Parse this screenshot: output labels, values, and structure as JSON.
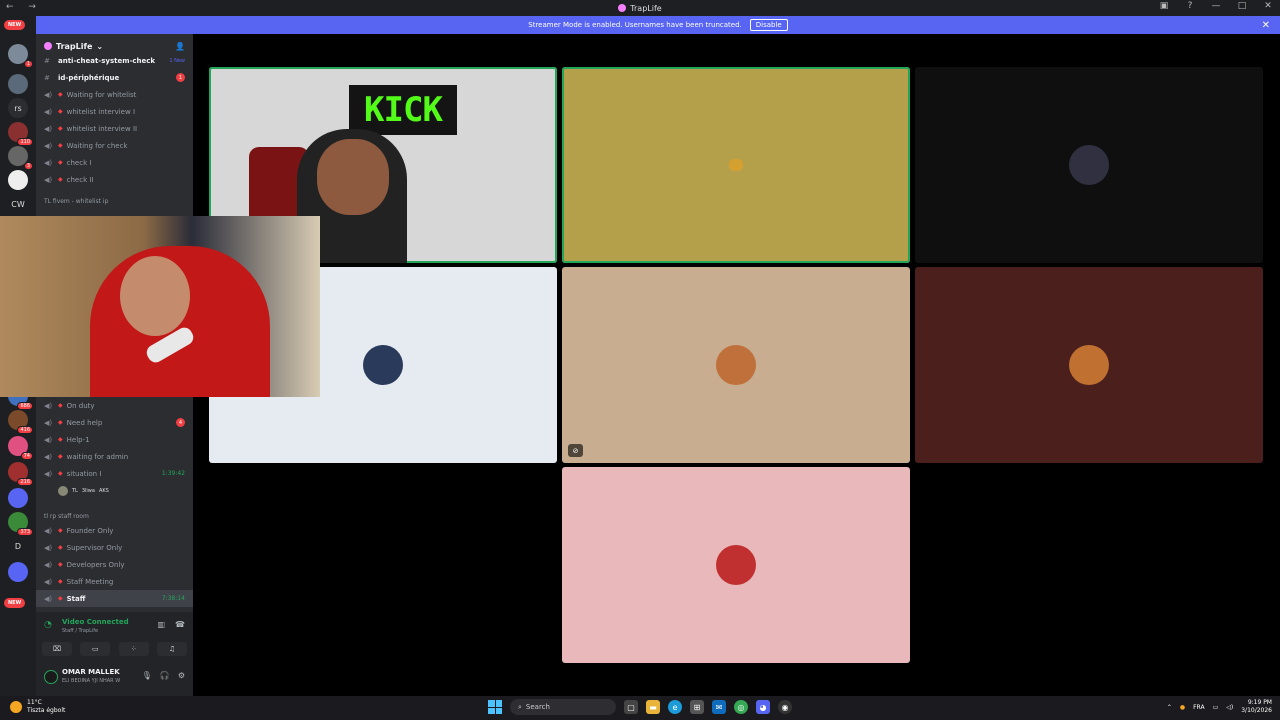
{
  "window": {
    "title": "TrapLife"
  },
  "banner": {
    "text": "Streamer Mode is enabled. Usernames have been truncated.",
    "button_label": "Disable"
  },
  "guilds": {
    "new_label": "NEW",
    "items": [
      {
        "label": "",
        "badge": "1",
        "color": "#7c8a99"
      },
      {
        "label": "",
        "badge": "",
        "color": "#5a6a7a"
      },
      {
        "label": "rs",
        "badge": "",
        "color": "#2b2d31"
      },
      {
        "label": "",
        "badge": "110",
        "color": "#8a3030"
      },
      {
        "label": "",
        "badge": "3",
        "color": "#666"
      },
      {
        "label": "",
        "badge": "",
        "color": "#eee"
      },
      {
        "label": "CW",
        "badge": "",
        "color": "#1e1f22"
      }
    ],
    "lower_items": [
      {
        "label": "",
        "badge": "686",
        "color": "#4070c0"
      },
      {
        "label": "",
        "badge": "416",
        "color": "#7a4a2a"
      },
      {
        "label": "",
        "badge": "74",
        "color": "#e05080"
      },
      {
        "label": "",
        "badge": "216",
        "color": "#a03030"
      },
      {
        "label": "",
        "badge": "",
        "color": "#5865f2"
      },
      {
        "label": "",
        "badge": "373",
        "color": "#3a8a3a"
      },
      {
        "label": "D",
        "badge": "",
        "color": "#1e1f22"
      },
      {
        "label": "",
        "badge": "",
        "color": "#5865f2"
      }
    ]
  },
  "sidebar": {
    "server_name": "TrapLife",
    "channels_top": [
      {
        "name": "anti-cheat-system-check",
        "type": "text",
        "bold": true,
        "note": "1 New"
      },
      {
        "name": "id-périphérique",
        "type": "text",
        "bold": true,
        "badge": "1"
      },
      {
        "name": "Waiting for whitelist",
        "type": "voice"
      },
      {
        "name": "whitelist interview I",
        "type": "voice"
      },
      {
        "name": "whitelist interview II",
        "type": "voice"
      },
      {
        "name": "Waiting for check",
        "type": "voice"
      },
      {
        "name": "check I",
        "type": "voice"
      },
      {
        "name": "check II",
        "type": "voice"
      }
    ],
    "category_whitelist": "TL fivem - whitelist ip",
    "channels_mid": [
      {
        "name": "On duty",
        "type": "voice"
      },
      {
        "name": "Need help",
        "type": "voice",
        "badge": "4"
      },
      {
        "name": "Help-1",
        "type": "voice"
      },
      {
        "name": "waiting for admin",
        "type": "voice"
      },
      {
        "name": "situation I",
        "type": "voice",
        "timer": "1:39:42"
      }
    ],
    "situation_member": "TL",
    "situation_member_2": "3liwa",
    "situation_member_3": "AKS",
    "category_staff": "tl rp staff room",
    "channels_staff": [
      {
        "name": "Founder Only",
        "type": "voice"
      },
      {
        "name": "Supervisor Only",
        "type": "voice"
      },
      {
        "name": "Developers Only",
        "type": "voice"
      },
      {
        "name": "Staff Meeting",
        "type": "voice"
      },
      {
        "name": "Staff",
        "type": "voice",
        "timer": "7:38:14",
        "active": true
      }
    ]
  },
  "voice": {
    "status": "Video Connected",
    "location": "Staff / TrapLife"
  },
  "user": {
    "name": "OMAR MALLEK",
    "status": "ELI BEDINA YJI NHAR W"
  },
  "tiles": [
    {
      "type": "camera",
      "speaking": true,
      "bg": "#d7d7d7",
      "sign": "KICK"
    },
    {
      "type": "avatar",
      "speaking": true,
      "bg": "#b4a04a",
      "avatar_color": "#d4a030",
      "small": true
    },
    {
      "type": "avatar",
      "speaking": false,
      "bg": "#0f0f0f",
      "avatar_color": "#303040"
    },
    {
      "type": "avatar",
      "speaking": false,
      "bg": "#e6ebf2",
      "avatar_color": "#2a3a5a"
    },
    {
      "type": "avatar",
      "speaking": false,
      "bg": "#c8ad90",
      "avatar_color": "#c0703a",
      "stream": true
    },
    {
      "type": "avatar",
      "speaking": false,
      "bg": "#4a1f1c",
      "avatar_color": "#c07030"
    },
    {
      "type": "avatar",
      "speaking": false,
      "bg": "#e9b8ba",
      "avatar_color": "#c03030"
    }
  ],
  "taskbar": {
    "temperature": "11°C",
    "weather": "Tiszta égbolt",
    "search_placeholder": "Search",
    "language": "FRA",
    "time": "9:19 PM",
    "date": "3/10/2026"
  },
  "colors": {
    "accent": "#5865f2",
    "online": "#23a55a",
    "alert": "#f23f43"
  }
}
